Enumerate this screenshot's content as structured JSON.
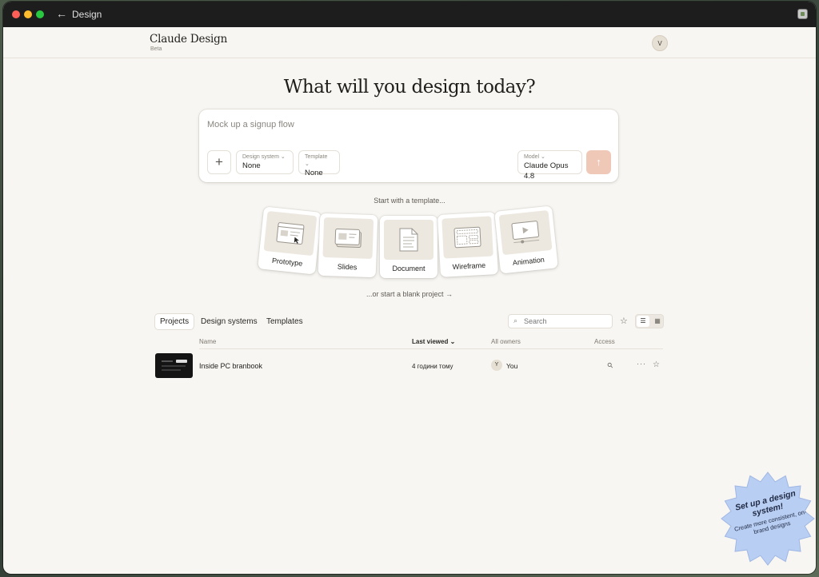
{
  "window": {
    "title": "Design",
    "back_icon": "arrow-left-icon",
    "extension_icon": "extension-icon"
  },
  "header": {
    "brand": "Claude Design",
    "badge": "Beta",
    "avatar_initial": "V"
  },
  "hero": {
    "title": "What will you design today?"
  },
  "composer": {
    "placeholder": "Mock up a signup flow",
    "add_icon": "plus-icon",
    "design_system": {
      "label": "Design system",
      "value": "None"
    },
    "template": {
      "label": "Template",
      "value": "None"
    },
    "model": {
      "label": "Model",
      "value": "Claude Opus 4.8"
    },
    "send_icon": "arrow-up-icon",
    "send_color": "#f0c8b8"
  },
  "templates": {
    "hint": "Start with a template...",
    "items": [
      {
        "label": "Prototype",
        "icon": "prototype-icon"
      },
      {
        "label": "Slides",
        "icon": "slides-icon"
      },
      {
        "label": "Document",
        "icon": "document-icon"
      },
      {
        "label": "Wireframe",
        "icon": "wireframe-icon"
      },
      {
        "label": "Animation",
        "icon": "animation-icon"
      }
    ],
    "blank_link": "...or start a blank project →"
  },
  "projects": {
    "tabs": [
      "Projects",
      "Design systems",
      "Templates"
    ],
    "active_tab": "Projects",
    "search_placeholder": "Search",
    "columns": {
      "name": "Name",
      "last_viewed": "Last viewed",
      "owners": "All owners",
      "access": "Access"
    },
    "rows": [
      {
        "name": "Inside PC branbook",
        "last_viewed": "4 години тому",
        "owner_initial": "Y",
        "owner": "You"
      }
    ]
  },
  "promo": {
    "title": "Set up a design system!",
    "subtitle": "Create more consistent, on-brand designs",
    "color": "#b9cef3"
  }
}
